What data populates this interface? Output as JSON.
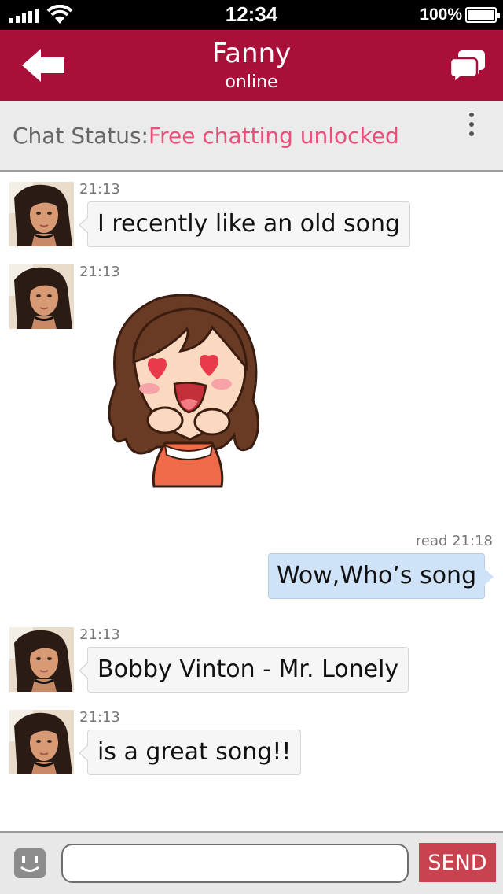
{
  "status_bar": {
    "time": "12:34",
    "battery": "100%"
  },
  "header": {
    "contact_name": "Fanny",
    "contact_status": "online",
    "accent_color": "#a8103a"
  },
  "chat_status": {
    "label": "Chat Status:",
    "value": "Free chatting unlocked",
    "value_color": "#e8507a"
  },
  "messages": [
    {
      "direction": "incoming",
      "time": "21:13",
      "type": "text",
      "text": "I recently like an old song"
    },
    {
      "direction": "incoming",
      "time": "21:13",
      "type": "sticker",
      "sticker": "in-love-girl-sticker"
    },
    {
      "direction": "outgoing",
      "status": "read 21:18",
      "type": "text",
      "text": "Wow,Who’s song"
    },
    {
      "direction": "incoming",
      "time": "21:13",
      "type": "text",
      "text": "Bobby Vinton - Mr. Lonely"
    },
    {
      "direction": "incoming",
      "time": "21:13",
      "type": "text",
      "text": "is a great song!!"
    }
  ],
  "input_bar": {
    "placeholder": "",
    "value": "",
    "send_label": "SEND"
  },
  "icons": {
    "back": "back-arrow-icon",
    "chat_list": "chat-bubbles-icon",
    "more": "more-vertical-icon",
    "emoji": "emoji-icon"
  }
}
